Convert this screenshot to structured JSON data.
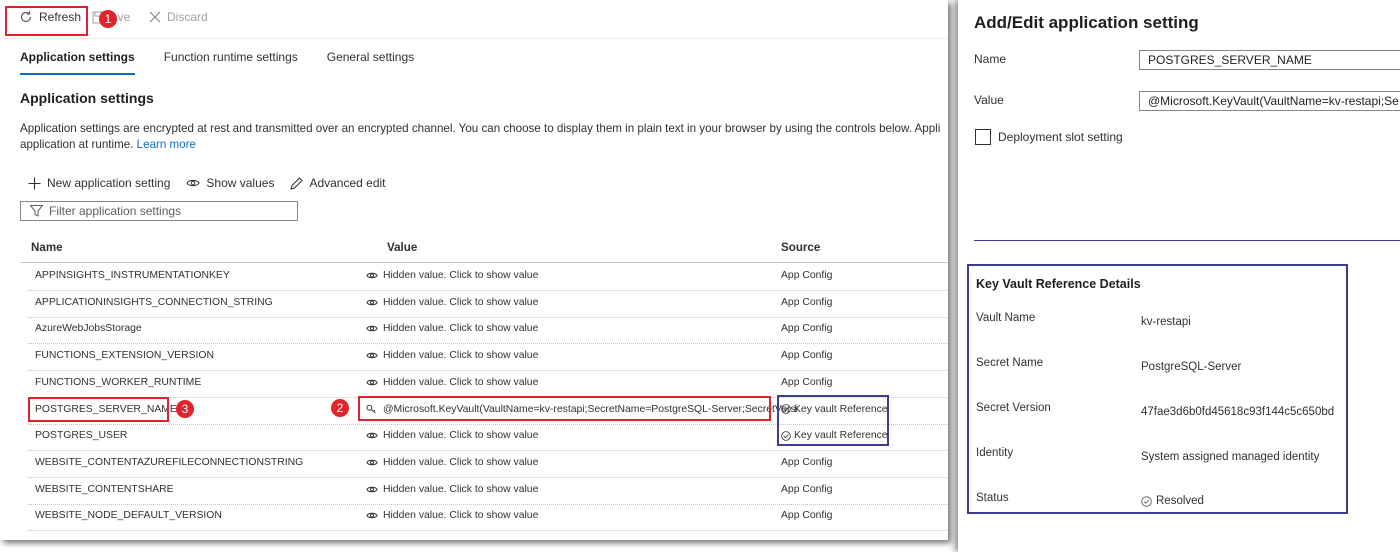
{
  "toolbar": {
    "refresh_label": "Refresh",
    "save_label": "Save",
    "save_visible": "ave",
    "discard_label": "Discard"
  },
  "tabs": [
    {
      "label": "Application settings",
      "active": true
    },
    {
      "label": "Function runtime settings",
      "active": false
    },
    {
      "label": "General settings",
      "active": false
    }
  ],
  "section": {
    "title": "Application settings",
    "description_line1": "Application settings are encrypted at rest and transmitted over an encrypted channel. You can choose to display them in plain text in your browser by using the controls below. Appli",
    "description_line2": "application at runtime.",
    "learn_more": "Learn more"
  },
  "actions": {
    "new_setting": "New application setting",
    "show_values": "Show values",
    "advanced_edit": "Advanced edit"
  },
  "filter": {
    "placeholder": "Filter application settings"
  },
  "table": {
    "columns": {
      "name": "Name",
      "value": "Value",
      "source": "Source"
    },
    "rows": [
      {
        "name": "APPINSIGHTS_INSTRUMENTATIONKEY",
        "value": "Hidden value. Click to show value",
        "source": "App Config",
        "kv": false
      },
      {
        "name": "APPLICATIONINSIGHTS_CONNECTION_STRING",
        "value": "Hidden value. Click to show value",
        "source": "App Config",
        "kv": false
      },
      {
        "name": "AzureWebJobsStorage",
        "value": "Hidden value. Click to show value",
        "source": "App Config",
        "kv": false
      },
      {
        "name": "FUNCTIONS_EXTENSION_VERSION",
        "value": "Hidden value. Click to show value",
        "source": "App Config",
        "kv": false
      },
      {
        "name": "FUNCTIONS_WORKER_RUNTIME",
        "value": "Hidden value. Click to show value",
        "source": "App Config",
        "kv": false
      },
      {
        "name": "POSTGRES_SERVER_NAME",
        "value": "@Microsoft.KeyVault(VaultName=kv-restapi;SecretName=PostgreSQL-Server;SecretVersi",
        "source": "Key vault Reference",
        "kv": true
      },
      {
        "name": "POSTGRES_USER",
        "value": "Hidden value. Click to show value",
        "source": "Key vault Reference",
        "kv": true
      },
      {
        "name": "WEBSITE_CONTENTAZUREFILECONNECTIONSTRING",
        "value": "Hidden value. Click to show value",
        "source": "App Config",
        "kv": false
      },
      {
        "name": "WEBSITE_CONTENTSHARE",
        "value": "Hidden value. Click to show value",
        "source": "App Config",
        "kv": false
      },
      {
        "name": "WEBSITE_NODE_DEFAULT_VERSION",
        "value": "Hidden value. Click to show value",
        "source": "App Config",
        "kv": false
      }
    ]
  },
  "badges": [
    "1",
    "2",
    "3"
  ],
  "panel": {
    "title": "Add/Edit application setting",
    "name_label": "Name",
    "name_value": "POSTGRES_SERVER_NAME",
    "value_label": "Value",
    "value_value": "@Microsoft.KeyVault(VaultName=kv-restapi;Se",
    "slot_label": "Deployment slot setting",
    "slot_checked": false
  },
  "kv_details": {
    "title": "Key Vault Reference Details",
    "items": [
      {
        "label": "Vault Name",
        "value": "kv-restapi"
      },
      {
        "label": "Secret Name",
        "value": "PostgreSQL-Server"
      },
      {
        "label": "Secret Version",
        "value": "47fae3d6b0fd45618c93f144c5c650bd"
      },
      {
        "label": "Identity",
        "value": "System assigned managed identity"
      },
      {
        "label": "Status",
        "value": "Resolved"
      }
    ]
  },
  "colors": {
    "annotation_red": "#e0242b",
    "annotation_blue": "#3e3d8f",
    "accent": "#0f6cbd"
  }
}
